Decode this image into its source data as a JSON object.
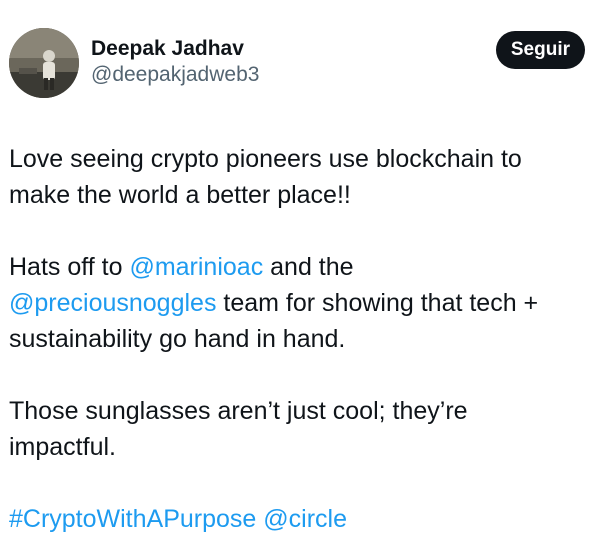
{
  "author": {
    "display_name": "Deepak Jadhav",
    "handle": "@deepakjadweb3",
    "avatar_icon": "user-avatar-photo"
  },
  "follow_button": {
    "label": "Seguir",
    "bg_color": "#0f1419",
    "text_color": "#ffffff"
  },
  "tweet": {
    "line1": "Love seeing crypto pioneers use blockchain to",
    "line2": "make the world a better place!!",
    "p2_prefix": "Hats off to ",
    "mention_marinioac": "@marinioac",
    "p2_mid": " and the",
    "mention_preciousnoggles": "@preciousnoggles",
    "p2_suffix_line": " team for showing that tech +",
    "p2_line3": "sustainability go hand in hand.",
    "p3_line1": "Those sunglasses aren’t just cool; they’re",
    "p3_line2": "impactful.",
    "hashtag": "#CryptoWithAPurpose",
    "mention_circle": "@circle",
    "link_color": "#1d9bf0"
  }
}
